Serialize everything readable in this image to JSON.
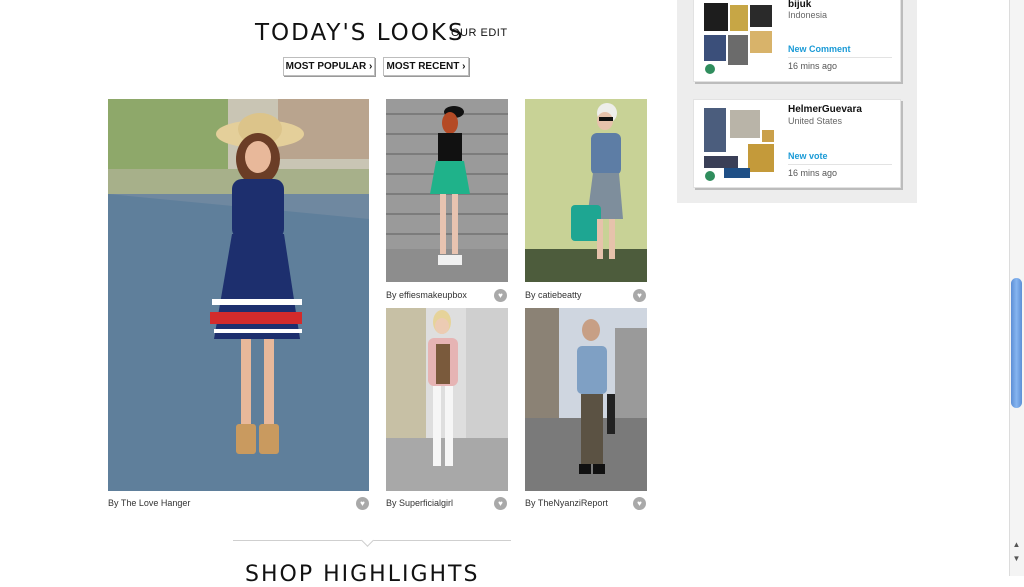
{
  "looks": {
    "title": "TODAY'S LOOKS",
    "subtitle": "OUR EDIT",
    "buttons": {
      "most_popular": "MOST POPULAR ›",
      "most_recent": "MOST RECENT ›"
    },
    "items": [
      {
        "credit": "By The Love Hanger"
      },
      {
        "credit": "By effiesmakeupbox"
      },
      {
        "credit": "By catiebeatty"
      },
      {
        "credit": "By Superficialgirl"
      },
      {
        "credit": "By TheNyanziReport"
      }
    ],
    "heart_glyph": "♥"
  },
  "activity": {
    "items": [
      {
        "user": "bijuk",
        "location": "Indonesia",
        "type": "New Comment",
        "time": "16 mins ago"
      },
      {
        "user": "HelmerGuevara",
        "location": "United States",
        "type": "New vote",
        "time": "16 mins ago"
      }
    ]
  },
  "shop": {
    "title": "SHOP HIGHLIGHTS"
  },
  "scrollbar": {
    "up": "▲",
    "down": "▼"
  },
  "colors": {
    "link_blue": "#1a9ad6",
    "panel_gray": "#ededed",
    "scroll_blue": "#6fa3e6"
  }
}
